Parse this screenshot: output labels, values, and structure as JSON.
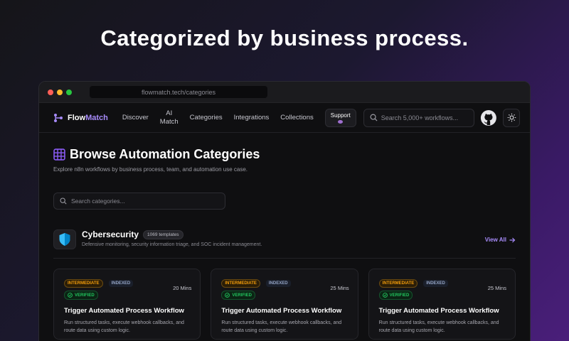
{
  "headline": "Categorized by business process.",
  "browser": {
    "url": "flowmatch.tech/categories"
  },
  "nav": {
    "logo_prefix": "Flow",
    "logo_suffix": "Match",
    "links": [
      "Discover",
      "AI",
      "Match",
      "Categories",
      "Integrations",
      "Collections"
    ],
    "support_label": "Support",
    "search_placeholder": "Search 5,000+ workflows..."
  },
  "page": {
    "title": "Browse Automation Categories",
    "subtitle": "Explore n8n workflows by business process, team, and automation use case.",
    "category_search_placeholder": "Search categories..."
  },
  "section": {
    "name": "Cybersecurity",
    "count": "1069 templates",
    "description": "Defensive monitoring, security information triage, and SOC incident management.",
    "view_all": "View All"
  },
  "cards": [
    {
      "level": "INTERMEDIATE",
      "indexed": "INDEXED",
      "verified": "VERIFIED",
      "duration": "20 Mins",
      "title": "Trigger Automated Process Workflow",
      "desc_line1": "Run structured tasks, execute webhook callbacks, and",
      "desc_line2": "route data using custom logic."
    },
    {
      "level": "INTERMEDIATE",
      "indexed": "INDEXED",
      "verified": "VERIFIED",
      "duration": "25 Mins",
      "title": "Trigger Automated Process Workflow",
      "desc_line1": "Run structured tasks, execute webhook callbacks, and",
      "desc_line2": "route data using custom logic."
    },
    {
      "level": "INTERMEDIATE",
      "indexed": "INDEXED",
      "verified": "VERIFIED",
      "duration": "25 Mins",
      "title": "Trigger Automated Process Workflow",
      "desc_line1": "Run structured tasks, execute webhook callbacks, and",
      "desc_line2": "route data using custom logic."
    }
  ],
  "colors": {
    "accent": "#a78bfa",
    "intermediate": "#f59e0b",
    "verified": "#22c55e"
  },
  "icons": [
    "logo-icon",
    "search-icon",
    "github-icon",
    "sun-icon",
    "grid-icon",
    "shield-icon",
    "arrow-right-icon",
    "check-icon"
  ]
}
